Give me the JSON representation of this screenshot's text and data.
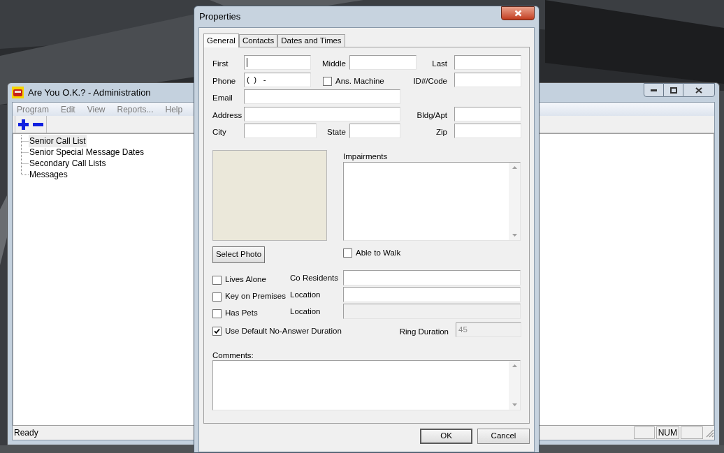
{
  "main_window": {
    "title": "Are You O.K.? - Administration",
    "menu": [
      "Program",
      "Edit",
      "View",
      "Reports...",
      "Help"
    ],
    "tree": [
      {
        "label": "Senior Call List",
        "selected": true
      },
      {
        "label": "Senior Special Message Dates",
        "selected": false
      },
      {
        "label": "Secondary Call Lists",
        "selected": false
      },
      {
        "label": "Messages",
        "selected": false
      }
    ],
    "status_text": "Ready",
    "indicators": [
      "NUM"
    ]
  },
  "dialog": {
    "title": "Properties",
    "tabs": [
      {
        "label": "General",
        "selected": true
      },
      {
        "label": "Contacts",
        "selected": false
      },
      {
        "label": "Dates and Times",
        "selected": false
      }
    ],
    "first": {
      "label": "First"
    },
    "middle": {
      "label": "Middle"
    },
    "last": {
      "label": "Last"
    },
    "phone": {
      "label": "Phone",
      "value": "(  )   -"
    },
    "ans_machine": {
      "label": "Ans. Machine",
      "checked": false
    },
    "id_code": {
      "label": "ID#/Code"
    },
    "email": {
      "label": "Email"
    },
    "address": {
      "label": "Address"
    },
    "bldg_apt": {
      "label": "Bldg/Apt"
    },
    "city": {
      "label": "City"
    },
    "state": {
      "label": "State"
    },
    "zip": {
      "label": "Zip"
    },
    "impairments": {
      "label": "Impairments"
    },
    "select_photo": "Select Photo",
    "able_to_walk": {
      "label": "Able to Walk",
      "checked": false
    },
    "lives_alone": {
      "label": "Lives Alone",
      "checked": false
    },
    "co_residents": {
      "label": "Co Residents",
      "disabled": false
    },
    "key_on_premises": {
      "label": "Key on Premises",
      "checked": false
    },
    "key_location": {
      "label": "Location",
      "disabled": false
    },
    "has_pets": {
      "label": "Has Pets",
      "checked": false
    },
    "pets_location": {
      "label": "Location",
      "disabled": true
    },
    "use_default": {
      "label": "Use Default No-Answer Duration",
      "checked": true
    },
    "ring_duration": {
      "label": "Ring Duration",
      "value": "45",
      "disabled": true
    },
    "comments": {
      "label": "Comments:"
    },
    "buttons": [
      "OK",
      "Cancel"
    ]
  }
}
